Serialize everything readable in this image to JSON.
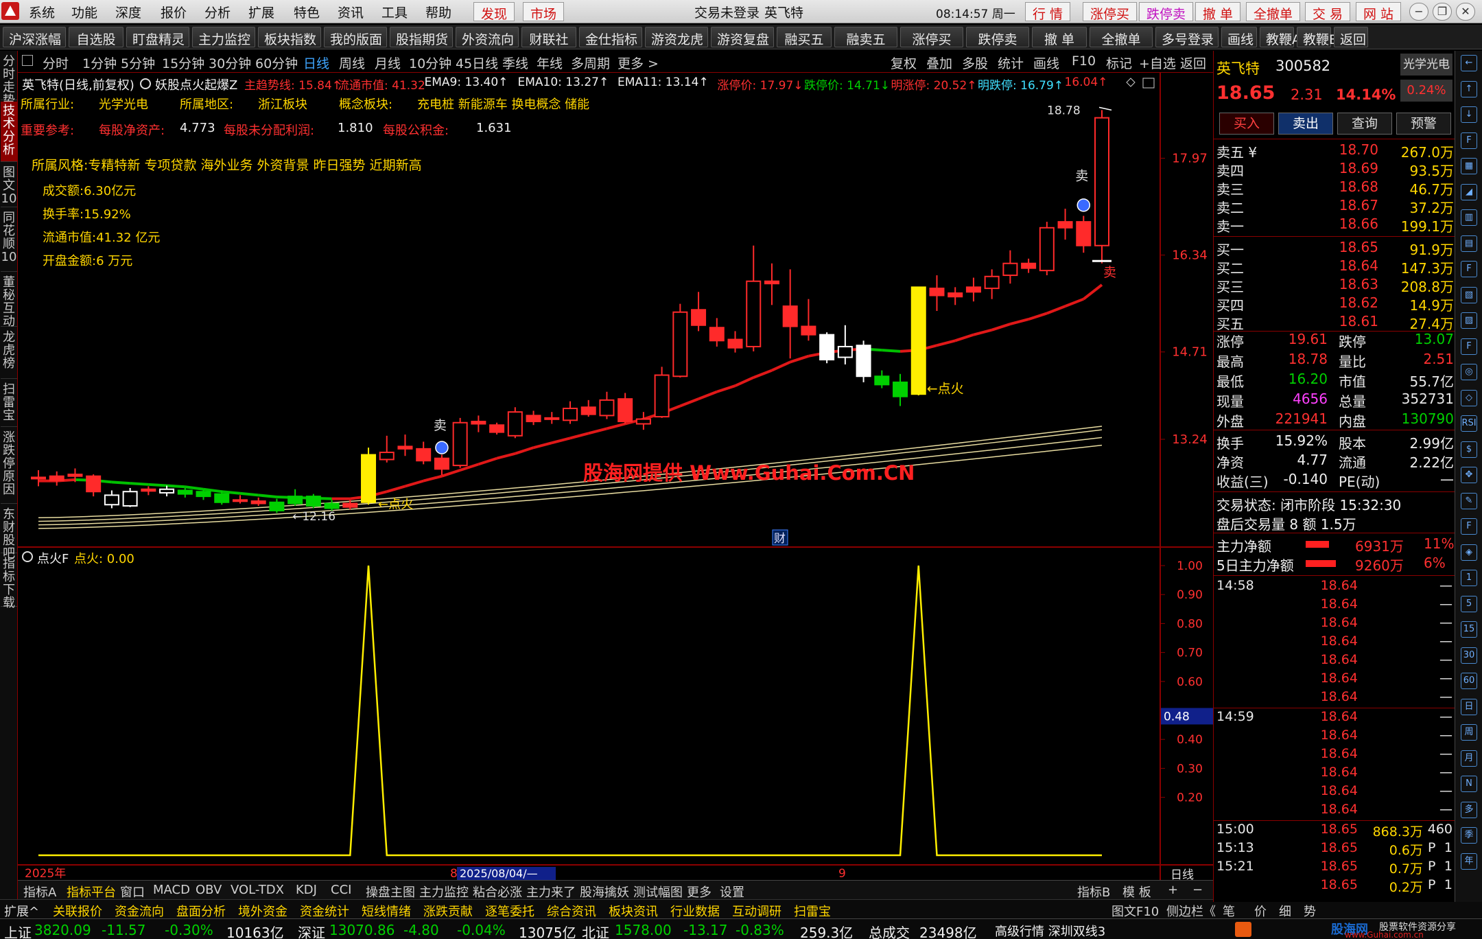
{
  "menubar": {
    "items": [
      "系统",
      "功能",
      "深度",
      "报价",
      "分析",
      "扩展",
      "特色",
      "资讯",
      "工具",
      "帮助"
    ],
    "highlight": [
      "发现",
      "市场"
    ],
    "status": "交易未登录",
    "stock": "英飞特",
    "time": "08:14:57 周一",
    "buttons": [
      "行 情",
      "涨停买",
      "跌停卖",
      "撤 单",
      "全撤单",
      "交 易",
      "网 站"
    ]
  },
  "toolbar": {
    "buttons": [
      "沪深涨幅",
      "自选股",
      "盯盘精灵",
      "主力监控",
      "板块指数",
      "我的版面",
      "股指期货",
      "外资流向",
      "财联社",
      "金仕指标",
      "游资龙虎",
      "游资复盘",
      "融买五",
      "融卖五",
      "涨停买",
      "跌停卖",
      "撤 单",
      "全撤单",
      "多号登录",
      "画线",
      "教鞭A",
      "教鞭B",
      "返回"
    ]
  },
  "left_tabs": [
    "分时走势",
    "技术分析",
    "图文10",
    "同花顺10",
    "董秘互动",
    "龙虎榜",
    "扫雷宝",
    "涨跌停原因",
    "东财股吧",
    "指标下载"
  ],
  "periods": {
    "items": [
      "分时",
      "1分钟",
      "5分钟",
      "15分钟",
      "30分钟",
      "60分钟",
      "日线",
      "周线",
      "月线",
      "10分钟",
      "45日线",
      "季线",
      "年线",
      "多周期",
      "更多 >"
    ],
    "active": "日线",
    "tools": [
      "复权",
      "叠加",
      "多股",
      "统计",
      "画线",
      "F10",
      "标记",
      "+自选",
      "返回"
    ]
  },
  "chart_header": {
    "title": "英飞特(日线,前复权)",
    "indicator": "妖股点火起爆Z",
    "values": [
      {
        "label": "主趋势线: 15.84↑",
        "color": "#ff3030"
      },
      {
        "label": "流通市值: 41.32",
        "color": "#ff3030"
      },
      {
        "label": "EMA9: 13.40↑",
        "color": "#f0f0f0"
      },
      {
        "label": "EMA10: 13.27↑",
        "color": "#f0f0f0"
      },
      {
        "label": "EMA11: 13.14↑",
        "color": "#f0f0f0"
      },
      {
        "label": "涨停价: 17.97↓",
        "color": "#ff3030"
      },
      {
        "label": "跌停价: 14.71↓",
        "color": "#00d000"
      },
      {
        "label": "明涨停: 20.52↑",
        "color": "#ff3030"
      },
      {
        "label": "明跌停: 16.79↑",
        "color": "#40e0ff"
      },
      {
        "label": "16.04↑",
        "color": "#ff3030"
      }
    ]
  },
  "info": {
    "industry_label": "所属行业:",
    "industry": "光学光电",
    "region_label": "所属地区:",
    "region": "浙江板块",
    "concept_label": "概念板块:",
    "concept": "充电桩 新能源车 换电概念 储能",
    "ref_label": "重要参考:",
    "nav_label": "每股净资产:",
    "nav": "4.773",
    "undist_label": "每股未分配利润:",
    "undist": "1.810",
    "reserve_label": "每股公积金:",
    "reserve": "1.631",
    "style": "所属风格:专精特新 专项贷款 海外业务 外资背景 昨日强势 近期新高",
    "turnover_amt": "成交额:6.30亿元",
    "turnover_rate": "换手率:15.92%",
    "float_mv": "流通市值:41.32 亿元",
    "open_amt": "开盘金额:6 万元"
  },
  "chart_data": {
    "type": "candlestick",
    "y_axis_ticks": [
      17.97,
      16.34,
      14.71,
      13.24
    ],
    "ylim": [
      11.6,
      19.2
    ],
    "candles": [
      {
        "o": 12.58,
        "h": 12.72,
        "l": 12.45,
        "c": 12.6,
        "t": "flat"
      },
      {
        "o": 12.55,
        "h": 12.7,
        "l": 12.46,
        "c": 12.62,
        "t": "flat"
      },
      {
        "o": 12.62,
        "h": 12.75,
        "l": 12.52,
        "c": 12.65,
        "t": "flat"
      },
      {
        "o": 12.62,
        "h": 12.65,
        "l": 12.28,
        "c": 12.36,
        "t": "down_red"
      },
      {
        "o": 12.3,
        "h": 12.38,
        "l": 12.08,
        "c": 12.14,
        "t": "up_white"
      },
      {
        "o": 12.12,
        "h": 12.42,
        "l": 12.1,
        "c": 12.36,
        "t": "up_white"
      },
      {
        "o": 12.37,
        "h": 12.45,
        "l": 12.3,
        "c": 12.4,
        "t": "flat"
      },
      {
        "o": 12.34,
        "h": 12.46,
        "l": 12.28,
        "c": 12.4,
        "t": "up_white"
      },
      {
        "o": 12.38,
        "h": 12.42,
        "l": 12.26,
        "c": 12.32,
        "t": "down_green"
      },
      {
        "o": 12.36,
        "h": 12.4,
        "l": 12.22,
        "c": 12.28,
        "t": "down_green"
      },
      {
        "o": 12.32,
        "h": 12.38,
        "l": 12.14,
        "c": 12.18,
        "t": "down_green"
      },
      {
        "o": 12.22,
        "h": 12.3,
        "l": 12.16,
        "c": 12.2,
        "t": "flat"
      },
      {
        "o": 12.2,
        "h": 12.26,
        "l": 12.12,
        "c": 12.16,
        "t": "flat"
      },
      {
        "o": 12.18,
        "h": 12.24,
        "l": 12.0,
        "c": 12.04,
        "t": "down_green"
      },
      {
        "o": 12.16,
        "h": 12.4,
        "l": 12.12,
        "c": 12.28,
        "t": "down_green"
      },
      {
        "o": 12.28,
        "h": 12.32,
        "l": 12.08,
        "c": 12.12,
        "t": "down_green"
      },
      {
        "o": 12.16,
        "h": 12.22,
        "l": 12.04,
        "c": 12.08,
        "t": "down_green"
      },
      {
        "o": 12.1,
        "h": 12.22,
        "l": 12.06,
        "c": 12.16,
        "t": "flat"
      },
      {
        "o": 12.18,
        "h": 13.1,
        "l": 12.14,
        "c": 12.98,
        "t": "up_yellow"
      },
      {
        "o": 12.9,
        "h": 13.3,
        "l": 12.85,
        "c": 13.02,
        "t": "up_red"
      },
      {
        "o": 13.08,
        "h": 13.32,
        "l": 12.96,
        "c": 13.12,
        "t": "flat"
      },
      {
        "o": 13.08,
        "h": 13.2,
        "l": 12.82,
        "c": 12.88,
        "t": "down_red"
      },
      {
        "o": 12.92,
        "h": 12.98,
        "l": 12.64,
        "c": 12.74,
        "t": "down_red"
      },
      {
        "o": 12.8,
        "h": 13.6,
        "l": 12.76,
        "c": 13.52,
        "t": "up_red"
      },
      {
        "o": 13.5,
        "h": 13.64,
        "l": 13.36,
        "c": 13.54,
        "t": "flat"
      },
      {
        "o": 13.48,
        "h": 13.52,
        "l": 13.32,
        "c": 13.36,
        "t": "down_red"
      },
      {
        "o": 13.3,
        "h": 13.78,
        "l": 13.26,
        "c": 13.7,
        "t": "up_red"
      },
      {
        "o": 13.64,
        "h": 13.72,
        "l": 13.48,
        "c": 13.54,
        "t": "down_red"
      },
      {
        "o": 13.58,
        "h": 13.7,
        "l": 13.5,
        "c": 13.6,
        "t": "flat"
      },
      {
        "o": 13.56,
        "h": 13.88,
        "l": 13.5,
        "c": 13.76,
        "t": "up_red"
      },
      {
        "o": 13.78,
        "h": 13.9,
        "l": 13.62,
        "c": 13.66,
        "t": "down_red"
      },
      {
        "o": 13.64,
        "h": 14.04,
        "l": 13.58,
        "c": 13.9,
        "t": "up_red"
      },
      {
        "o": 13.92,
        "h": 14.02,
        "l": 13.5,
        "c": 13.54,
        "t": "down_red"
      },
      {
        "o": 13.5,
        "h": 13.7,
        "l": 13.4,
        "c": 13.58,
        "t": "up_red"
      },
      {
        "o": 13.62,
        "h": 14.46,
        "l": 13.6,
        "c": 14.32,
        "t": "up_red"
      },
      {
        "o": 14.3,
        "h": 15.52,
        "l": 14.28,
        "c": 15.38,
        "t": "up_red"
      },
      {
        "o": 15.42,
        "h": 15.72,
        "l": 15.06,
        "c": 15.16,
        "t": "down_red"
      },
      {
        "o": 15.12,
        "h": 15.28,
        "l": 14.8,
        "c": 14.9,
        "t": "down_red"
      },
      {
        "o": 14.92,
        "h": 15.06,
        "l": 14.7,
        "c": 14.78,
        "t": "down_red"
      },
      {
        "o": 14.8,
        "h": 16.5,
        "l": 14.72,
        "c": 15.9,
        "t": "up_red"
      },
      {
        "o": 15.9,
        "h": 16.2,
        "l": 15.5,
        "c": 15.86,
        "t": "flat"
      },
      {
        "o": 15.48,
        "h": 16.1,
        "l": 14.6,
        "c": 15.14,
        "t": "down_red"
      },
      {
        "o": 15.14,
        "h": 15.6,
        "l": 14.9,
        "c": 15.0,
        "t": "flat"
      },
      {
        "o": 15.0,
        "h": 15.04,
        "l": 14.52,
        "c": 14.58,
        "t": "down_white"
      },
      {
        "o": 14.62,
        "h": 15.16,
        "l": 14.5,
        "c": 14.8,
        "t": "up_white"
      },
      {
        "o": 14.82,
        "h": 14.9,
        "l": 14.2,
        "c": 14.3,
        "t": "down_white"
      },
      {
        "o": 14.3,
        "h": 14.4,
        "l": 14.1,
        "c": 14.16,
        "t": "down_green"
      },
      {
        "o": 14.2,
        "h": 14.34,
        "l": 13.8,
        "c": 13.96,
        "t": "down_green"
      },
      {
        "o": 14.0,
        "h": 15.8,
        "l": 13.98,
        "c": 15.8,
        "t": "up_yellow"
      },
      {
        "o": 15.78,
        "h": 16.0,
        "l": 15.4,
        "c": 15.66,
        "t": "down_red"
      },
      {
        "o": 15.64,
        "h": 15.8,
        "l": 15.5,
        "c": 15.7,
        "t": "flat"
      },
      {
        "o": 15.72,
        "h": 15.96,
        "l": 15.56,
        "c": 15.8,
        "t": "flat"
      },
      {
        "o": 15.78,
        "h": 16.1,
        "l": 15.6,
        "c": 15.98,
        "t": "up_red"
      },
      {
        "o": 16.0,
        "h": 16.42,
        "l": 15.86,
        "c": 16.2,
        "t": "up_red"
      },
      {
        "o": 16.2,
        "h": 16.28,
        "l": 16.04,
        "c": 16.12,
        "t": "down_red"
      },
      {
        "o": 16.08,
        "h": 16.9,
        "l": 16.0,
        "c": 16.8,
        "t": "up_red"
      },
      {
        "o": 16.8,
        "h": 17.12,
        "l": 16.6,
        "c": 16.9,
        "t": "down_red"
      },
      {
        "o": 16.9,
        "h": 17.0,
        "l": 16.38,
        "c": 16.5,
        "t": "down_red"
      },
      {
        "o": 16.5,
        "h": 18.78,
        "l": 16.2,
        "c": 18.65,
        "t": "up_red"
      }
    ],
    "trend_line": [
      12.54,
      12.54,
      12.56,
      12.55,
      12.52,
      12.5,
      12.48,
      12.46,
      12.44,
      12.4,
      12.36,
      12.33,
      12.3,
      12.27,
      12.26,
      12.25,
      12.24,
      12.24,
      12.28,
      12.36,
      12.45,
      12.54,
      12.62,
      12.72,
      12.82,
      12.92,
      13.0,
      13.1,
      13.18,
      13.26,
      13.34,
      13.42,
      13.5,
      13.58,
      13.68,
      13.8,
      13.92,
      14.04,
      14.14,
      14.28,
      14.4,
      14.54,
      14.64,
      14.7,
      14.74,
      14.76,
      14.74,
      14.72,
      14.74,
      14.82,
      14.9,
      15.0,
      15.08,
      15.18,
      15.26,
      15.36,
      15.48,
      15.6,
      15.84
    ],
    "ema9_end": 13.4,
    "ema10_end": 13.27,
    "ema11_end": 13.14,
    "annotations": {
      "low_label": "←12.16",
      "high_label": "18.78",
      "fire_label_1": "←点火",
      "fire_label_2": "←点火",
      "sell_label_1": "卖",
      "sell_label_2": "卖",
      "sell_label_3": "卖",
      "fin_label": "财"
    }
  },
  "watermark": "股海网提供 Www.Guhai.Com.CN",
  "indicator": {
    "title": "点火F",
    "value_label": "点火: 0.00",
    "y_ticks": [
      1.0,
      0.9,
      0.8,
      0.7,
      0.6,
      0.4,
      0.3,
      0.2
    ],
    "cursor_value": "0.48",
    "spikes_at_index": [
      18,
      48
    ]
  },
  "x_axis": {
    "year": "2025年",
    "marker1": "8",
    "date_cursor": "2025/08/04/—",
    "marker2": "9",
    "period": "日线"
  },
  "right": {
    "name": "英飞特",
    "code": "300582",
    "sector": "光学光电",
    "price": "18.65",
    "change": "2.31",
    "pct": "14.14%",
    "sector_pct": "0.24%",
    "trade_buttons": [
      "买入",
      "卖出",
      "查询",
      "预警"
    ],
    "asks": [
      {
        "label": "卖五 ¥",
        "price": "18.70",
        "vol": "267.0万"
      },
      {
        "label": "卖四",
        "price": "18.69",
        "vol": "93.5万"
      },
      {
        "label": "卖三",
        "price": "18.68",
        "vol": "46.7万"
      },
      {
        "label": "卖二",
        "price": "18.67",
        "vol": "37.2万"
      },
      {
        "label": "卖一",
        "price": "18.66",
        "vol": "199.1万"
      }
    ],
    "bids": [
      {
        "label": "买一",
        "price": "18.65",
        "vol": "91.9万"
      },
      {
        "label": "买二",
        "price": "18.64",
        "vol": "147.3万"
      },
      {
        "label": "买三",
        "price": "18.63",
        "vol": "208.8万"
      },
      {
        "label": "买四",
        "price": "18.62",
        "vol": "14.9万"
      },
      {
        "label": "买五",
        "price": "18.61",
        "vol": "27.4万"
      }
    ],
    "stats": [
      {
        "l1": "涨停",
        "v1": "19.61",
        "c1": "#ff3030",
        "l2": "跌停",
        "v2": "13.07",
        "c2": "#00d000"
      },
      {
        "l1": "最高",
        "v1": "18.78",
        "c1": "#ff3030",
        "l2": "量比",
        "v2": "2.51",
        "c2": "#ff3030"
      },
      {
        "l1": "最低",
        "v1": "16.20",
        "c1": "#00d000",
        "l2": "市值",
        "v2": "55.7亿",
        "c2": "#e8e8e8"
      },
      {
        "l1": "现量",
        "v1": "4656",
        "c1": "#ff40ff",
        "l2": "总量",
        "v2": "352731",
        "c2": "#e8e8e8"
      },
      {
        "l1": "外盘",
        "v1": "221941",
        "c1": "#ff3030",
        "l2": "内盘",
        "v2": "130790",
        "c2": "#00d000"
      }
    ],
    "stats2": [
      {
        "l1": "换手",
        "v1": "15.92%",
        "l2": "股本",
        "v2": "2.99亿"
      },
      {
        "l1": "净资",
        "v1": "4.77",
        "l2": "流通",
        "v2": "2.22亿"
      },
      {
        "l1": "收益(三)",
        "v1": "-0.140",
        "l2": "PE(动)",
        "v2": "—"
      }
    ],
    "trade_status": "交易状态: 闭市阶段 15:32:30",
    "after_hours": "盘后交易量 8 额 1.5万",
    "main_net": {
      "label": "主力净额",
      "value": "6931万",
      "pct": "11%"
    },
    "main_net5": {
      "label": "5日主力净额",
      "value": "9260万",
      "pct": "6%"
    },
    "ticks": [
      {
        "time": "14:58",
        "price": "18.64",
        "vol": "",
        "dir": "",
        "cnt": "—"
      },
      {
        "time": "",
        "price": "18.64",
        "vol": "",
        "dir": "",
        "cnt": "—"
      },
      {
        "time": "",
        "price": "18.64",
        "vol": "",
        "dir": "",
        "cnt": "—"
      },
      {
        "time": "",
        "price": "18.64",
        "vol": "",
        "dir": "",
        "cnt": "—"
      },
      {
        "time": "",
        "price": "18.64",
        "vol": "",
        "dir": "",
        "cnt": "—"
      },
      {
        "time": "",
        "price": "18.64",
        "vol": "",
        "dir": "",
        "cnt": "—"
      },
      {
        "time": "",
        "price": "18.64",
        "vol": "",
        "dir": "",
        "cnt": "—"
      },
      {
        "time": "14:59",
        "price": "18.64",
        "vol": "",
        "dir": "",
        "cnt": "—"
      },
      {
        "time": "",
        "price": "18.64",
        "vol": "",
        "dir": "",
        "cnt": "—"
      },
      {
        "time": "",
        "price": "18.64",
        "vol": "",
        "dir": "",
        "cnt": "—"
      },
      {
        "time": "",
        "price": "18.64",
        "vol": "",
        "dir": "",
        "cnt": "—"
      },
      {
        "time": "",
        "price": "18.64",
        "vol": "",
        "dir": "",
        "cnt": "—"
      },
      {
        "time": "",
        "price": "18.64",
        "vol": "",
        "dir": "",
        "cnt": "—"
      },
      {
        "time": "15:00",
        "price": "18.65",
        "vol": "868.3万",
        "dir": "",
        "cnt": "460"
      },
      {
        "time": "15:13",
        "price": "18.65",
        "vol": "0.6万",
        "dir": "P",
        "cnt": "1"
      },
      {
        "time": "15:21",
        "price": "18.65",
        "vol": "0.7万",
        "dir": "P",
        "cnt": "1"
      },
      {
        "time": "",
        "price": "18.65",
        "vol": "0.2万",
        "dir": "P",
        "cnt": "1"
      }
    ],
    "right_icons": [
      "←",
      "↑",
      "↓",
      "F",
      "▦",
      "◢",
      "▥",
      "▤",
      "F",
      "▧",
      "▨",
      "F",
      "◎",
      "◇",
      "RSI",
      "$",
      "✥",
      "✎",
      "F",
      "◈",
      "1",
      "5",
      "15",
      "30",
      "60",
      "日",
      "周",
      "月",
      "N",
      "多",
      "季",
      "年"
    ]
  },
  "bottom_tabs1": {
    "items": [
      "指标A",
      "指标平台",
      "窗口",
      "MACD",
      "OBV",
      "VOL-TDX",
      "KDJ",
      "CCI",
      "操盘主图",
      "主力监控",
      "粘合必涨",
      "主力来了",
      "股海擒妖",
      "测试幅图",
      "更多",
      "设置"
    ],
    "right": [
      "指标B",
      "模 板",
      "+",
      "−"
    ]
  },
  "bottom_tabs2": {
    "items": [
      "扩展^",
      "关联报价",
      "资金流向",
      "盘面分析",
      "境外资金",
      "资金统计",
      "短线情绪",
      "涨跌贡献",
      "逐笔委托",
      "综合资讯",
      "板块资讯",
      "行业数据",
      "互动调研",
      "扫雷宝"
    ],
    "right": [
      "图文F10",
      "侧边栏《",
      "笔",
      "价",
      "细",
      "势"
    ]
  },
  "statusbar": {
    "sh_label": "上证",
    "sh": "3820.09",
    "sh_chg": "-11.57",
    "sh_pct": "-0.30%",
    "sh_amt": "10163亿",
    "sz_label": "深证",
    "sz": "13070.86",
    "sz_chg": "-4.80",
    "sz_pct": "-0.04%",
    "sz_amt": "13075亿",
    "bz_label": "北证",
    "bz": "1578.00",
    "bz_chg": "-13.17",
    "bz_pct": "-0.83%",
    "bz_amt": "259.3亿",
    "total_label": "总成交",
    "total": "23498亿",
    "mode": "高级行情 深圳双线3",
    "brand": "股海网",
    "brand_sub": "股票软件资源分享",
    "brand_url": "www.Guhai.com.cn"
  },
  "colors": {
    "up": "#ff3030",
    "down": "#00d000",
    "yellow": "#ffd600",
    "trend": "#e01818"
  }
}
